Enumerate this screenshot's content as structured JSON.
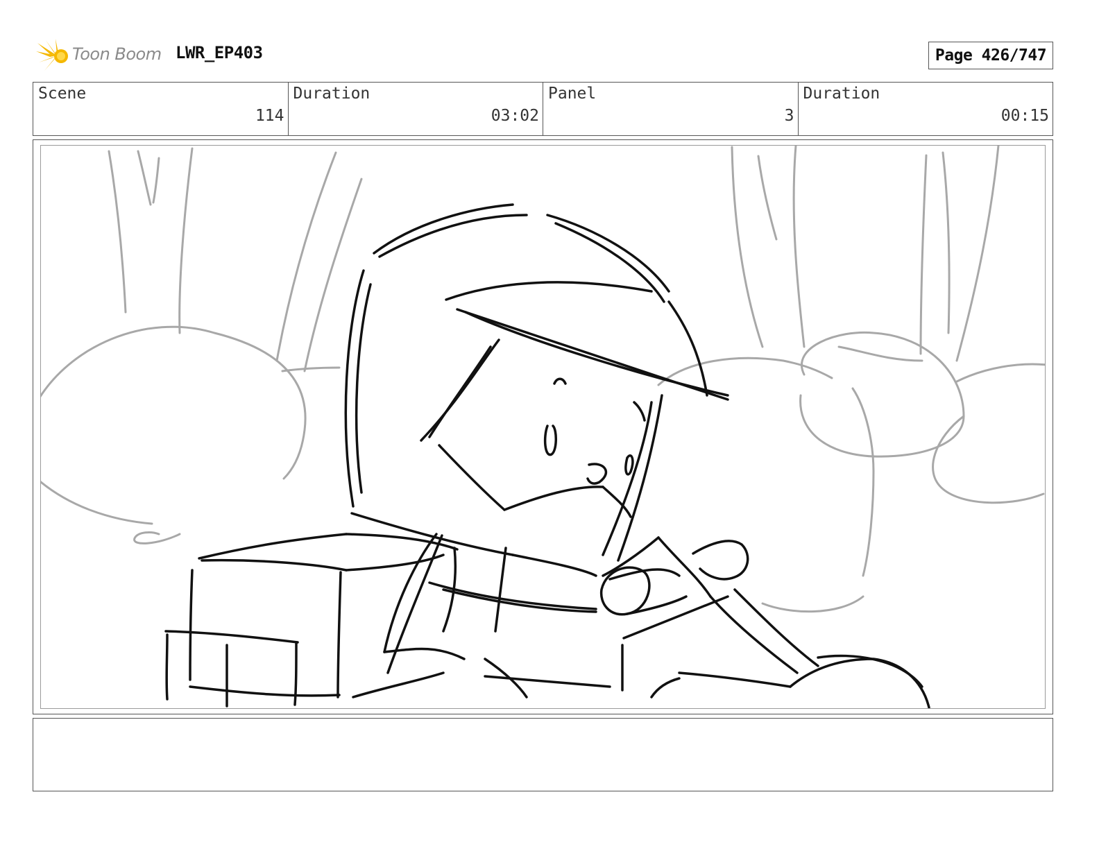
{
  "header": {
    "logo_text": "Toon Boom",
    "project": "LWR_EP403",
    "page": "Page 426/747"
  },
  "info": {
    "scene_label": "Scene",
    "scene_value": "114",
    "scene_duration_label": "Duration",
    "scene_duration_value": "03:02",
    "panel_label": "Panel",
    "panel_value": "3",
    "panel_duration_label": "Duration",
    "panel_duration_value": "00:15"
  },
  "colors": {
    "logo_accent": "#f5b800",
    "sketch_ink": "#111111",
    "background_sketch": "#a8a8a8"
  },
  "notes": {
    "text": ""
  }
}
